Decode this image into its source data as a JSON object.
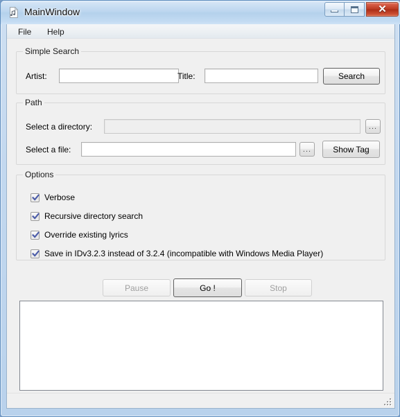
{
  "window": {
    "title": "MainWindow",
    "icon": "music-document-icon",
    "controls": {
      "minimize": "minimize-icon",
      "maximize": "maximize-icon",
      "close": "✕"
    },
    "colors": {
      "titlebar": "#b8d3ec",
      "client": "#f0f0f0",
      "close_button": "#bc3b22",
      "check_mark": "#4a5ba8"
    }
  },
  "menubar": {
    "items": [
      {
        "label": "File",
        "x": 10
      },
      {
        "label": "Help",
        "x": 52
      }
    ]
  },
  "simple_search": {
    "title": "Simple Search",
    "artist_label": "Artist:",
    "artist_value": "",
    "artist_placeholder": "",
    "title_label": "Title:",
    "title_value": "",
    "title_placeholder": "",
    "search_button": "Search"
  },
  "path": {
    "title": "Path",
    "directory_label": "Select a directory:",
    "directory_value": "",
    "directory_placeholder": "",
    "directory_browse_button": "...",
    "file_label": "Select a file:",
    "file_value": "",
    "file_placeholder": "",
    "file_browse_button": "...",
    "show_tag_button": "Show Tag"
  },
  "options": {
    "title": "Options",
    "items": [
      {
        "label": "Verbose",
        "checked": true
      },
      {
        "label": "Recursive directory search",
        "checked": true
      },
      {
        "label": "Override existing lyrics",
        "checked": true
      },
      {
        "label": "Save in IDv3.2.3 instead of 3.2.4 (incompatible with Windows Media Player)",
        "checked": true
      }
    ]
  },
  "actions": {
    "pause_button": "Pause",
    "go_button": "Go !",
    "stop_button": "Stop"
  },
  "log": {
    "content": ""
  },
  "statusbar": {
    "text": "",
    "grip": "resize-grip-icon"
  }
}
